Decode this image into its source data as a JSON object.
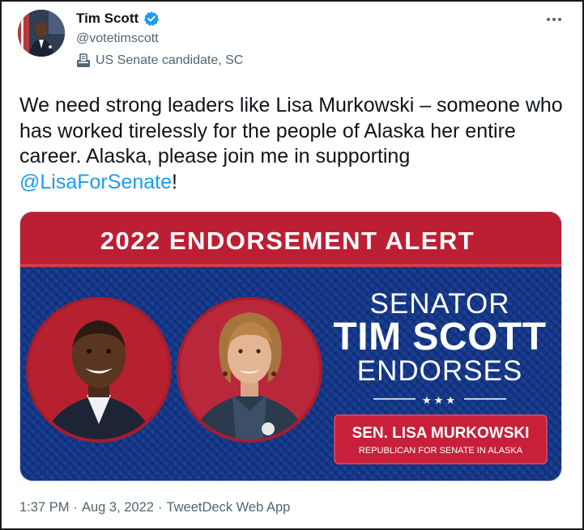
{
  "author": {
    "display_name": "Tim Scott",
    "handle": "@votetimscott",
    "label": "US Senate candidate, SC",
    "verified": true,
    "icons": {
      "verified": "verified-badge-icon",
      "label": "ballot-box-icon",
      "more": "more-horizontal-icon"
    }
  },
  "tweet": {
    "text_before": "We need strong leaders like Lisa Murkowski – someone who has worked tirelessly for the people of Alaska her entire career. Alaska, please join me in supporting ",
    "mention": "@LisaForSenate",
    "text_after": "!"
  },
  "media": {
    "banner": "2022 ENDORSEMENT ALERT",
    "line1": "SENATOR",
    "line2": "TIM SCOTT",
    "line3": "ENDORSES",
    "stars": "★★★",
    "badge_name": "SEN. LISA MURKOWSKI",
    "badge_sub": "REPUBLICAN FOR SENATE IN ALASKA"
  },
  "footer": {
    "time": "1:37 PM",
    "date": "Aug 3, 2022",
    "source": "TweetDeck Web App",
    "separator": "·"
  },
  "colors": {
    "link": "#1d9bf0",
    "secondary_text": "#536471",
    "banner_red": "#bc1f33",
    "panel_blue": "#13307a",
    "badge_red": "#c8203a"
  }
}
